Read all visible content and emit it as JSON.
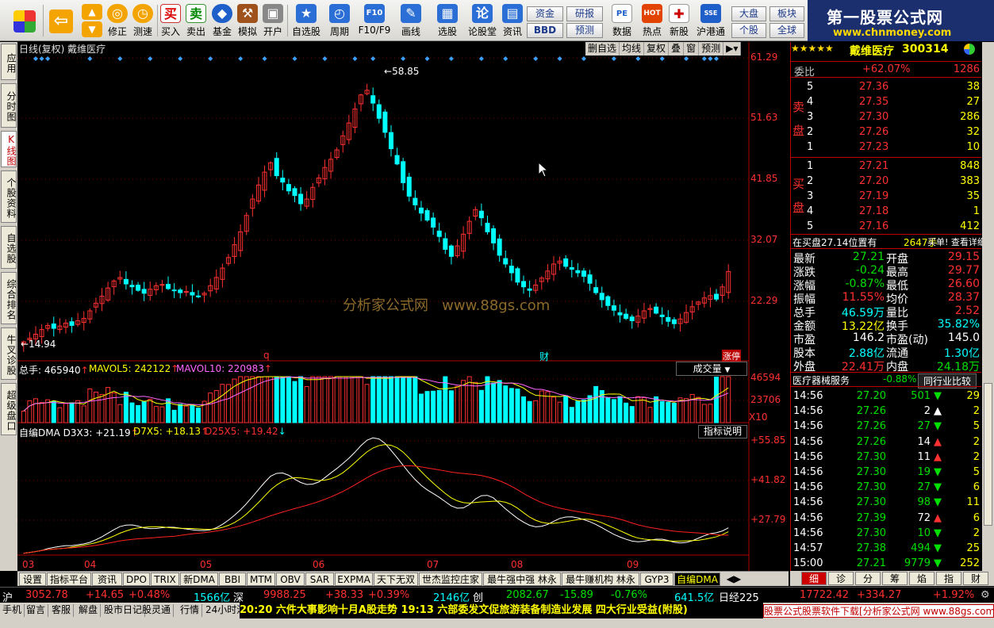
{
  "toolbar": {
    "items": [
      {
        "label": "修正"
      },
      {
        "label": "测速"
      },
      {
        "label": "买入"
      },
      {
        "label": "卖出"
      },
      {
        "label": "基金"
      },
      {
        "label": "模拟"
      },
      {
        "label": "开户"
      },
      {
        "label": "自选股"
      },
      {
        "label": "周期"
      },
      {
        "label": "F10/F9"
      },
      {
        "label": "画线"
      },
      {
        "label": "选股"
      },
      {
        "label": "论股堂"
      },
      {
        "label": "资讯"
      },
      {
        "label": "数据"
      },
      {
        "label": "热点"
      },
      {
        "label": "新股"
      },
      {
        "label": "沪港通"
      }
    ],
    "pills": [
      "资金",
      "BBD",
      "研报",
      "预测",
      "大盘",
      "个股",
      "板块",
      "全球"
    ],
    "icon_glyphs": {
      "buy": "买",
      "sell": "卖",
      "f10": "F10",
      "rt": "论",
      "hk": "SSE",
      "hot": "HOT",
      "ipo": "PE"
    },
    "logo_title": "第一股票公式网",
    "logo_url": "www.chnmoney.com"
  },
  "left_tabs": [
    "应用",
    "分时图",
    "K线图",
    "个股资料",
    "自选股",
    "综合排名",
    "牛叉诊股",
    "超级盘口"
  ],
  "chart": {
    "header": "日线(复权) 戴维医疗",
    "buttons": [
      "删自选",
      "均线",
      "复权",
      "叠",
      "窗",
      "预测"
    ],
    "price_axis": [
      "61.29",
      "51.63",
      "41.85",
      "32.07",
      "22.29"
    ],
    "high_label": "58.85",
    "low_label": "14.94",
    "event_labels": [
      "q",
      "财",
      "涨停"
    ],
    "watermark": "分析家公式网   www.88gs.com",
    "volume": {
      "title": "总手: 465940",
      "mavol5": "MAVOL5: 242122",
      "mavol10": "MAVOL10: 220983",
      "selector": "成交量",
      "axis": [
        "46594",
        "23706",
        "X10"
      ]
    },
    "indicator": {
      "title": "自编DMA D3X3: +21.19",
      "d7": "D7X5: +18.13",
      "d25": "D25X5: +19.42",
      "button": "指标说明",
      "axis": [
        "+55.85",
        "+41.82",
        "+27.79"
      ]
    },
    "months": [
      "03",
      "04",
      "05",
      "06",
      "07",
      "08",
      "09"
    ],
    "colors": {
      "up": "#ff3030",
      "down": "#00ffff",
      "line1": "#ffffff",
      "line2": "#ffff00",
      "line3": "#ff2020"
    }
  },
  "chart_data": {
    "type": "candlestick",
    "title": "日线(复权) 戴维医疗",
    "x": [
      "03",
      "04",
      "05",
      "06",
      "07",
      "08",
      "09"
    ],
    "ylim": [
      14.94,
      61.29
    ],
    "close": [
      15.2,
      15.8,
      16.5,
      17.3,
      18.0,
      17.5,
      17.9,
      18.4,
      18.0,
      18.8,
      19.2,
      20.5,
      21.8,
      23.0,
      24.4,
      25.6,
      26.2,
      25.1,
      24.6,
      24.0,
      23.5,
      24.2,
      24.8,
      25.0,
      24.3,
      24.0,
      23.6,
      23.8,
      23.2,
      23.0,
      23.5,
      24.8,
      26.2,
      27.8,
      29.6,
      31.8,
      34.0,
      36.8,
      39.6,
      42.0,
      44.2,
      45.8,
      43.6,
      42.5,
      41.0,
      40.2,
      38.8,
      39.6,
      41.6,
      43.2,
      45.0,
      46.4,
      48.0,
      50.4,
      52.6,
      55.0,
      57.4,
      58.2,
      56.0,
      53.4,
      51.0,
      48.2,
      45.6,
      42.4,
      40.1,
      38.6,
      37.2,
      36.0,
      34.8,
      33.2,
      31.0,
      29.8,
      31.6,
      33.6,
      35.8,
      37.8,
      36.4,
      34.0,
      32.1,
      30.0,
      28.5,
      27.0,
      25.4,
      24.6,
      24.0,
      24.9,
      26.1,
      27.3,
      28.5,
      29.0,
      28.1,
      27.6,
      27.0,
      26.4,
      25.2,
      23.6,
      22.4,
      21.4,
      20.6,
      19.8,
      19.2,
      18.8,
      19.6,
      20.5,
      20.9,
      20.1,
      19.5,
      18.7,
      18.3,
      19.1,
      20.2,
      21.2,
      22.0,
      22.7,
      23.1,
      22.5,
      24.6,
      27.21
    ],
    "volume_peak": 46594,
    "series": [
      {
        "name": "D3X3",
        "color": "#ffffff",
        "last": 21.19
      },
      {
        "name": "D7X5",
        "color": "#ffff00",
        "last": 18.13
      },
      {
        "name": "D25X5",
        "color": "#ff2020",
        "last": 19.42
      }
    ],
    "indicator_ylim": [
      14.0,
      55.85
    ]
  },
  "quote": {
    "stars": "★★★★★",
    "name": "戴维医疗",
    "code": "300314",
    "wb_label": "委比",
    "wb_value": "+62.07%",
    "wb_diff": "1286",
    "sell_label": "卖盘",
    "buy_label": "买盘",
    "sells": [
      {
        "lvl": "5",
        "price": "27.36",
        "vol": "38"
      },
      {
        "lvl": "4",
        "price": "27.35",
        "vol": "27"
      },
      {
        "lvl": "3",
        "price": "27.30",
        "vol": "286"
      },
      {
        "lvl": "2",
        "price": "27.26",
        "vol": "32"
      },
      {
        "lvl": "1",
        "price": "27.23",
        "vol": "10"
      }
    ],
    "buys": [
      {
        "lvl": "1",
        "price": "27.21",
        "vol": "848"
      },
      {
        "lvl": "2",
        "price": "27.20",
        "vol": "383"
      },
      {
        "lvl": "3",
        "price": "27.19",
        "vol": "35"
      },
      {
        "lvl": "4",
        "price": "27.18",
        "vol": "1"
      },
      {
        "lvl": "5",
        "price": "27.16",
        "vol": "412"
      }
    ],
    "note": "在买盘27.14位置有",
    "note_vol": "2647手",
    "note_tail": "买单! 查看详细",
    "stats": [
      {
        "l": "最新",
        "v": "27.21",
        "l2": "开盘",
        "v2": "29.15"
      },
      {
        "l": "涨跌",
        "v": "-0.24",
        "l2": "最高",
        "v2": "29.77"
      },
      {
        "l": "涨幅",
        "v": "-0.87%",
        "l2": "最低",
        "v2": "26.60"
      },
      {
        "l": "振幅",
        "v": "11.55%",
        "l2": "均价",
        "v2": "28.37"
      },
      {
        "l": "总手",
        "v": "46.59万",
        "l2": "量比",
        "v2": "2.52"
      },
      {
        "l": "金额",
        "v": "13.22亿",
        "l2": "换手",
        "v2": "35.82%"
      },
      {
        "l": "市盈",
        "v": "146.2",
        "l2": "市盈(动)",
        "v2": "145.0"
      },
      {
        "l": "股本",
        "v": "2.88亿",
        "l2": "流通",
        "v2": "1.30亿"
      },
      {
        "l": "外盘",
        "v": "22.41万",
        "l2": "内盘",
        "v2": "24.18万"
      }
    ],
    "sector": "医疗器械服务",
    "sector_chg": "-0.88%",
    "sector_btn": "同行业比较",
    "ticks": [
      {
        "t": "14:56",
        "p": "27.20",
        "v": "501",
        "d": "down",
        "n": "29"
      },
      {
        "t": "14:56",
        "p": "27.26",
        "v": "2",
        "d": "up",
        "n": "2"
      },
      {
        "t": "14:56",
        "p": "27.26",
        "v": "27",
        "d": "down",
        "n": "5"
      },
      {
        "t": "14:56",
        "p": "27.26",
        "v": "14",
        "d": "up",
        "n": "2"
      },
      {
        "t": "14:56",
        "p": "27.30",
        "v": "11",
        "d": "up",
        "n": "2"
      },
      {
        "t": "14:56",
        "p": "27.30",
        "v": "19",
        "d": "down",
        "n": "5"
      },
      {
        "t": "14:56",
        "p": "27.30",
        "v": "27",
        "d": "down",
        "n": "6"
      },
      {
        "t": "14:56",
        "p": "27.30",
        "v": "98",
        "d": "down",
        "n": "11"
      },
      {
        "t": "14:56",
        "p": "27.39",
        "v": "72",
        "d": "up",
        "n": "6"
      },
      {
        "t": "14:56",
        "p": "27.30",
        "v": "10",
        "d": "down",
        "n": "2"
      },
      {
        "t": "14:57",
        "p": "27.38",
        "v": "494",
        "d": "down",
        "n": "25"
      },
      {
        "t": "15:00",
        "p": "27.21",
        "v": "9779",
        "d": "down",
        "n": "252"
      }
    ]
  },
  "bottom_tabs": [
    "设置",
    "指标平台",
    "资讯",
    "DPO",
    "TRIX",
    "新DMA",
    "BBI",
    "MTM",
    "OBV",
    "SAR",
    "EXPMA",
    "天下无双",
    "世杰监控庄家",
    "最牛强中强 林永",
    "最牛赚机构 林永",
    "GYP3",
    "自编DMA"
  ],
  "right_tabs": [
    "细",
    "诊",
    "分",
    "筹",
    "焰",
    "指",
    "财"
  ],
  "index_bar": {
    "sh_label": "沪",
    "sh": "3052.78",
    "sh_chg": "+14.65",
    "sh_pct": "+0.48%",
    "sh_amt": "1566亿",
    "sz_label": "深",
    "sz": "9988.25",
    "sz_chg": "+38.33",
    "sz_pct": "+0.39%",
    "sz_amt": "2146亿",
    "cy_label": "创",
    "cy": "2082.67",
    "cy_chg": "-15.89",
    "cy_pct": "-0.76%",
    "cy_amt": "641.5亿",
    "rj_label": "日经225",
    "rj": "17722.42",
    "rj_chg": "+334.27",
    "rj_pct": "+1.92%"
  },
  "status": {
    "items": [
      "手机",
      "留言",
      "客服",
      "解盘",
      "股市日记",
      "股灵通",
      "行情",
      "24小时滚动"
    ],
    "news": "20:20 六件大事影响十月A股走势          19:13 六部委发文促旅游装备制造业发展 四大行业受益(附股)",
    "ad": "股票公式股票软件下载[分析家公式网 www.88gs.com]"
  }
}
